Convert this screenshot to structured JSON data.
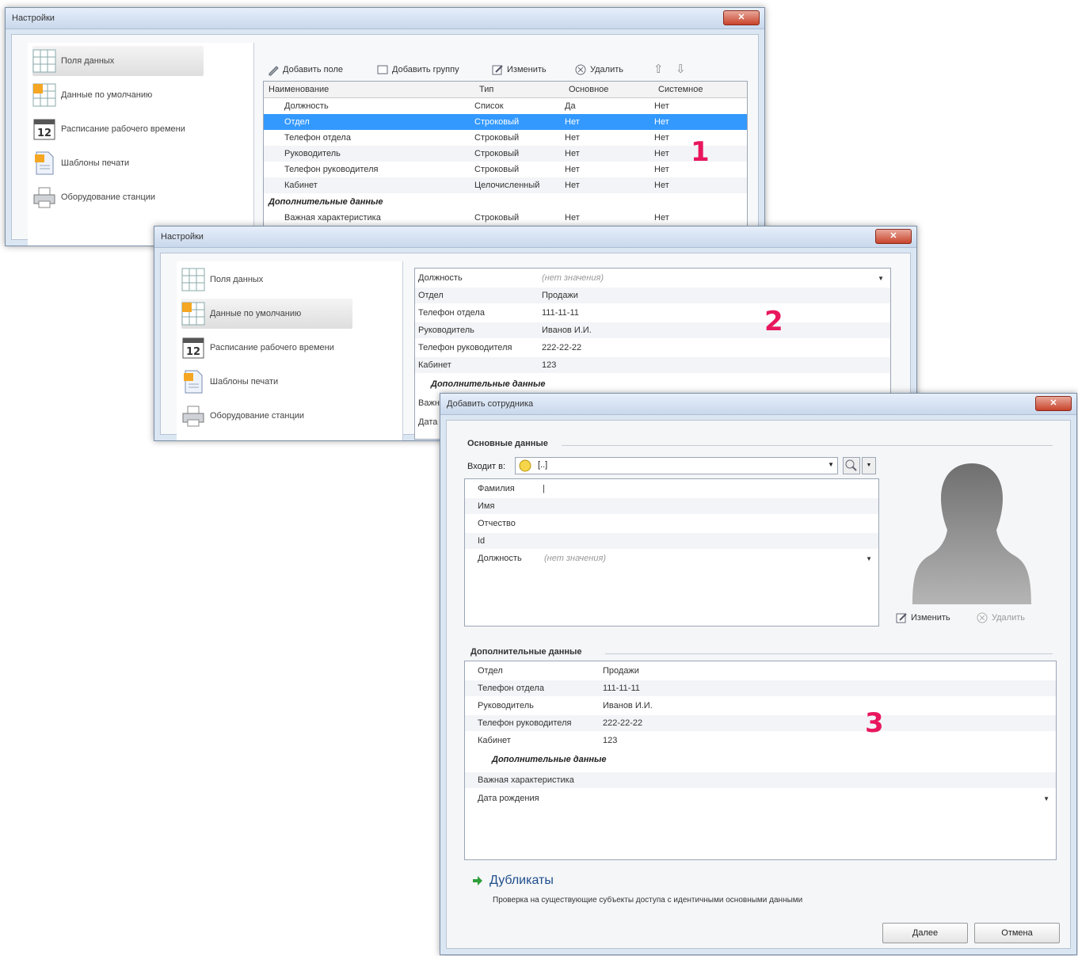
{
  "labels": {
    "l1": "1",
    "l2": "2",
    "l3": "3"
  },
  "win1": {
    "title": "Настройки",
    "close": "✕",
    "nav": [
      "Поля данных",
      "Данные по умолчанию",
      "Расписание рабочего времени",
      "Шаблоны печати",
      "Оборудование станции"
    ],
    "toolbar": {
      "add_field": "Добавить поле",
      "add_group": "Добавить группу",
      "edit": "Изменить",
      "delete": "Удалить",
      "up": "⇧",
      "down": "⇩"
    },
    "headers": [
      "Наименование",
      "Тип",
      "Основное",
      "Системное"
    ],
    "rows": [
      [
        "Должность",
        "Список",
        "Да",
        "Нет"
      ],
      [
        "Отдел",
        "Строковый",
        "Нет",
        "Нет"
      ],
      [
        "Телефон отдела",
        "Строковый",
        "Нет",
        "Нет"
      ],
      [
        "Руководитель",
        "Строковый",
        "Нет",
        "Нет"
      ],
      [
        "Телефон руководителя",
        "Строковый",
        "Нет",
        "Нет"
      ],
      [
        "Кабинет",
        "Целочисленный",
        "Нет",
        "Нет"
      ]
    ],
    "group": "Дополнительные данные",
    "extra_row": [
      "Важная характеристика",
      "Строковый",
      "Нет",
      "Нет"
    ]
  },
  "win2": {
    "title": "Настройки",
    "close": "✕",
    "nav": [
      "Поля данных",
      "Данные по умолчанию",
      "Расписание рабочего времени",
      "Шаблоны печати",
      "Оборудование станции"
    ],
    "fields": [
      [
        "Должность",
        "(нет значения)"
      ],
      [
        "Отдел",
        "Продажи"
      ],
      [
        "Телефон отдела",
        "111-11-11"
      ],
      [
        "Руководитель",
        "Иванов И.И."
      ],
      [
        "Телефон руководителя",
        "222-22-22"
      ],
      [
        "Кабинет",
        "123"
      ]
    ],
    "group": "Дополнительные данные",
    "cut_labels": [
      "Важн",
      "Дата"
    ]
  },
  "win3": {
    "title": "Добавить сотрудника",
    "close": "✕",
    "main_section": "Основные данные",
    "belongs_label": "Входит в:",
    "belongs_value": "[..]",
    "main_fields": [
      "Фамилия",
      "Имя",
      "Отчество",
      "Id",
      "Должность"
    ],
    "position_hint": "(нет значения)",
    "photo_edit": "Изменить",
    "photo_delete": "Удалить",
    "extra_section": "Дополнительные данные",
    "extra_fields": [
      [
        "Отдел",
        "Продажи"
      ],
      [
        "Телефон отдела",
        "111-11-11"
      ],
      [
        "Руководитель",
        "Иванов И.И."
      ],
      [
        "Телефон руководителя",
        "222-22-22"
      ],
      [
        "Кабинет",
        "123"
      ]
    ],
    "sub_group": "Дополнительные данные",
    "sub_fields": [
      "Важная характеристика",
      "Дата рождения"
    ],
    "duplicates_title": "Дубликаты",
    "duplicates_desc": "Проверка на существующие субъекты доступа с идентичными основными данными",
    "next": "Далее",
    "cancel": "Отмена"
  },
  "colors": {
    "selection": "#3399ff",
    "label": "#e8175d",
    "close": "#c8432b"
  }
}
